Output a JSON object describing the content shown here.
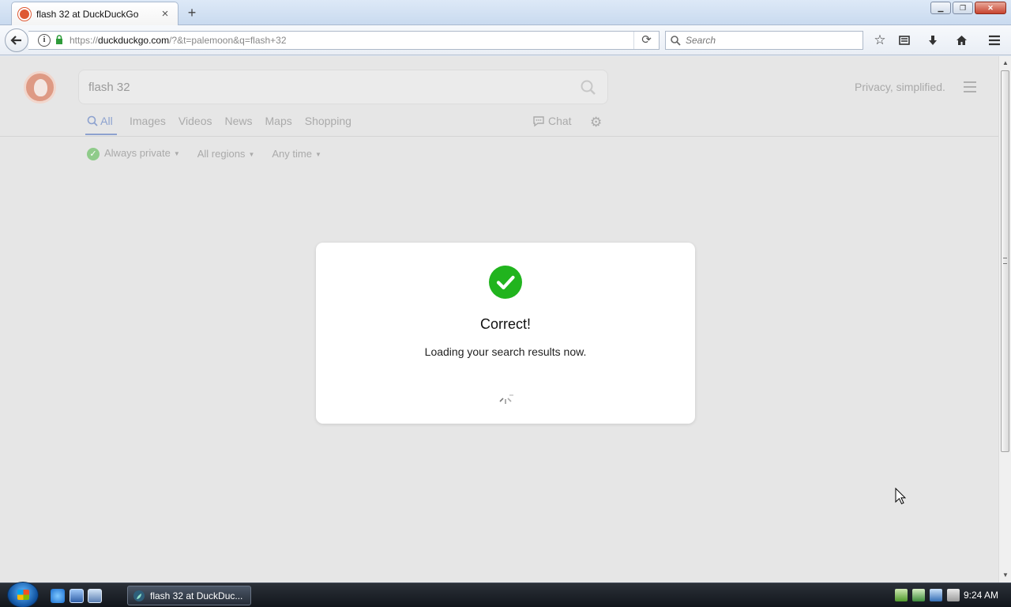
{
  "browser": {
    "tab": {
      "title": "flash 32 at DuckDuckGo",
      "close": "×"
    },
    "new_tab": "+",
    "url": {
      "prefix": "https://",
      "domain": "duckduckgo.com",
      "rest": "/?&t=palemoon&q=flash+32"
    },
    "search_placeholder": "Search"
  },
  "page": {
    "query": "flash 32",
    "tagline": "Privacy, simplified.",
    "tabs": [
      "All",
      "Images",
      "Videos",
      "News",
      "Maps",
      "Shopping"
    ],
    "active_tab": "All",
    "chat_label": "Chat",
    "filters": {
      "privacy": "Always private",
      "region": "All regions",
      "time": "Any time"
    }
  },
  "modal": {
    "title": "Correct!",
    "message": "Loading your search results now."
  },
  "taskbar": {
    "window_label": "flash 32 at DuckDuc...",
    "clock": "9:24 AM"
  },
  "colors": {
    "accent": "#de5833",
    "success": "#21b41e",
    "tab_active": "#8da2cf"
  }
}
